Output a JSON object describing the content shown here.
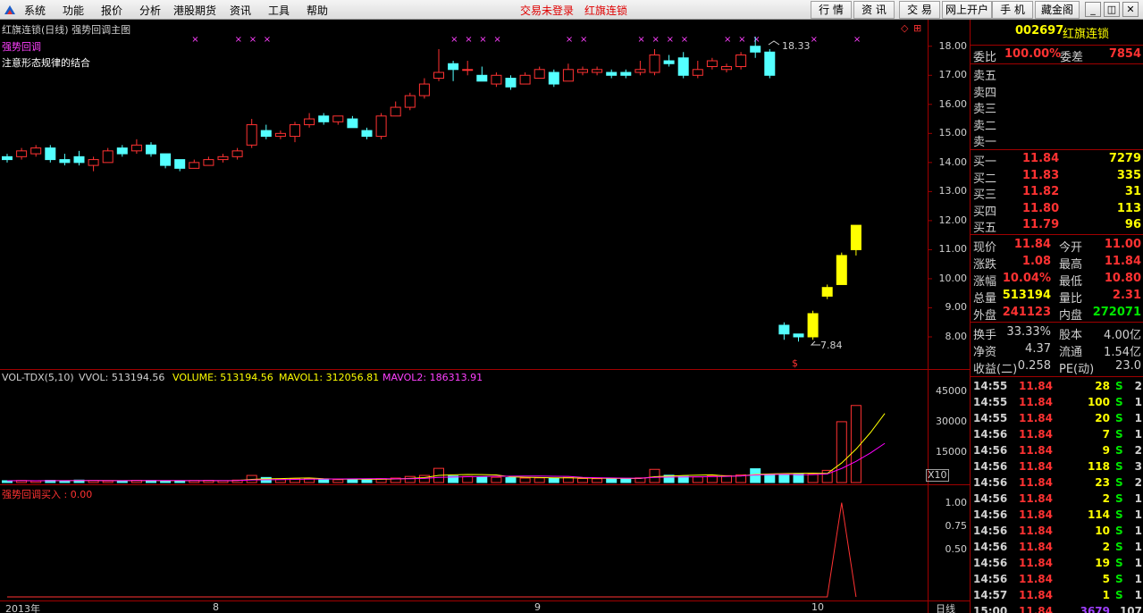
{
  "menubar": {
    "items": [
      "系统",
      "功能",
      "报价",
      "分析",
      "港股期货",
      "资讯",
      "工具",
      "帮助"
    ],
    "status": "交易未登录",
    "stock_name": "红旗连锁",
    "tabs": [
      "行 情",
      "资 讯",
      "交 易",
      "网上开户",
      "手 机",
      "藏金阁"
    ],
    "window_buttons": [
      "_",
      "◫",
      "✕"
    ]
  },
  "chart": {
    "header": "红旗连锁(日线) 强势回调主图",
    "indicator_name": "强势回调",
    "note": "注意形态规律的结合",
    "high_marker": "18.33",
    "low_marker": "7.84",
    "s_marker": "$",
    "x10_label": "X10",
    "period_label": "日线",
    "price_axis": [
      "18.00",
      "17.00",
      "16.00",
      "15.00",
      "14.00",
      "13.00",
      "12.00",
      "11.00",
      "10.00",
      "9.00",
      "8.00"
    ],
    "vol_header": {
      "name": "VOL-TDX(5,10)",
      "vvol": "VVOL: 513194.56",
      "volume": "VOLUME: 513194.56",
      "mavol1": "MAVOL1: 312056.81",
      "mavol2": "MAVOL2: 186313.91"
    },
    "vol_axis": [
      "45000",
      "30000",
      "15000"
    ],
    "sig_header": "强势回调买入 : 0.00",
    "sig_axis": [
      "1.00",
      "0.75",
      "0.50"
    ],
    "date_labels": [
      "2013年",
      "8",
      "9",
      "10"
    ],
    "colors": {
      "up": "#ff3232",
      "down": "#54ffff",
      "yellow": "#ffff00",
      "magenta": "#ff00ff",
      "frame": "#a00000"
    }
  },
  "chart_data": {
    "type": "candlestick",
    "title": "红旗连锁(日线) 强势回调主图",
    "ylim": [
      7.6,
      18.3
    ],
    "candles": [
      {
        "o": 14.2,
        "c": 14.1,
        "h": 14.3,
        "l": 14.0
      },
      {
        "o": 14.2,
        "c": 14.4,
        "h": 14.5,
        "l": 14.1
      },
      {
        "o": 14.3,
        "c": 14.5,
        "h": 14.6,
        "l": 14.2
      },
      {
        "o": 14.5,
        "c": 14.1,
        "h": 14.6,
        "l": 14.0
      },
      {
        "o": 14.1,
        "c": 14.0,
        "h": 14.3,
        "l": 13.9
      },
      {
        "o": 14.2,
        "c": 14.0,
        "h": 14.4,
        "l": 13.9
      },
      {
        "o": 13.9,
        "c": 14.1,
        "h": 14.2,
        "l": 13.7
      },
      {
        "o": 14.0,
        "c": 14.4,
        "h": 14.5,
        "l": 14.0
      },
      {
        "o": 14.5,
        "c": 14.3,
        "h": 14.6,
        "l": 14.2
      },
      {
        "o": 14.4,
        "c": 14.6,
        "h": 14.8,
        "l": 14.3
      },
      {
        "o": 14.6,
        "c": 14.3,
        "h": 14.7,
        "l": 14.2
      },
      {
        "o": 14.3,
        "c": 13.9,
        "h": 14.3,
        "l": 13.8
      },
      {
        "o": 14.1,
        "c": 13.8,
        "h": 14.1,
        "l": 13.7
      },
      {
        "o": 13.8,
        "c": 14.0,
        "h": 14.1,
        "l": 13.8
      },
      {
        "o": 13.9,
        "c": 14.1,
        "h": 14.2,
        "l": 13.9
      },
      {
        "o": 14.1,
        "c": 14.2,
        "h": 14.3,
        "l": 14.0
      },
      {
        "o": 14.2,
        "c": 14.4,
        "h": 14.5,
        "l": 14.1
      },
      {
        "o": 14.6,
        "c": 15.3,
        "h": 15.5,
        "l": 14.5
      },
      {
        "o": 15.1,
        "c": 14.9,
        "h": 15.3,
        "l": 14.8
      },
      {
        "o": 14.9,
        "c": 15.0,
        "h": 15.1,
        "l": 14.8
      },
      {
        "o": 14.9,
        "c": 15.3,
        "h": 15.4,
        "l": 14.7
      },
      {
        "o": 15.3,
        "c": 15.5,
        "h": 15.7,
        "l": 15.2
      },
      {
        "o": 15.6,
        "c": 15.4,
        "h": 15.7,
        "l": 15.3
      },
      {
        "o": 15.4,
        "c": 15.6,
        "h": 15.6,
        "l": 15.3
      },
      {
        "o": 15.5,
        "c": 15.2,
        "h": 15.6,
        "l": 15.2
      },
      {
        "o": 15.1,
        "c": 14.9,
        "h": 15.2,
        "l": 14.8
      },
      {
        "o": 14.9,
        "c": 15.6,
        "h": 15.7,
        "l": 14.8
      },
      {
        "o": 15.6,
        "c": 15.9,
        "h": 16.1,
        "l": 15.6
      },
      {
        "o": 15.9,
        "c": 16.3,
        "h": 16.4,
        "l": 15.8
      },
      {
        "o": 16.3,
        "c": 16.7,
        "h": 16.9,
        "l": 16.2
      },
      {
        "o": 16.9,
        "c": 17.1,
        "h": 17.9,
        "l": 16.8
      },
      {
        "o": 17.4,
        "c": 17.2,
        "h": 17.5,
        "l": 16.8
      },
      {
        "o": 17.2,
        "c": 17.2,
        "h": 17.5,
        "l": 17.0
      },
      {
        "o": 17.0,
        "c": 16.8,
        "h": 17.3,
        "l": 16.8
      },
      {
        "o": 16.7,
        "c": 17.0,
        "h": 17.1,
        "l": 16.6
      },
      {
        "o": 16.9,
        "c": 16.6,
        "h": 17.0,
        "l": 16.5
      },
      {
        "o": 16.7,
        "c": 17.0,
        "h": 17.1,
        "l": 16.7
      },
      {
        "o": 16.9,
        "c": 17.2,
        "h": 17.3,
        "l": 16.9
      },
      {
        "o": 17.1,
        "c": 16.7,
        "h": 17.2,
        "l": 16.6
      },
      {
        "o": 16.8,
        "c": 17.2,
        "h": 17.4,
        "l": 16.8
      },
      {
        "o": 17.1,
        "c": 17.2,
        "h": 17.3,
        "l": 17.0
      },
      {
        "o": 17.1,
        "c": 17.2,
        "h": 17.3,
        "l": 17.0
      },
      {
        "o": 17.1,
        "c": 17.0,
        "h": 17.2,
        "l": 16.9
      },
      {
        "o": 17.1,
        "c": 17.0,
        "h": 17.2,
        "l": 16.9
      },
      {
        "o": 17.1,
        "c": 17.2,
        "h": 17.5,
        "l": 17.0
      },
      {
        "o": 17.1,
        "c": 17.7,
        "h": 17.9,
        "l": 17.0
      },
      {
        "o": 17.5,
        "c": 17.4,
        "h": 17.7,
        "l": 17.3
      },
      {
        "o": 17.6,
        "c": 17.0,
        "h": 17.8,
        "l": 16.9
      },
      {
        "o": 17.0,
        "c": 17.2,
        "h": 17.5,
        "l": 16.9
      },
      {
        "o": 17.3,
        "c": 17.5,
        "h": 17.6,
        "l": 17.2
      },
      {
        "o": 17.2,
        "c": 17.3,
        "h": 17.4,
        "l": 17.1
      },
      {
        "o": 17.3,
        "c": 17.7,
        "h": 17.8,
        "l": 17.2
      },
      {
        "o": 18.0,
        "c": 17.8,
        "h": 18.33,
        "l": 17.6
      },
      {
        "o": 17.8,
        "c": 17.0,
        "h": 17.9,
        "l": 16.9
      },
      {
        "o": 8.4,
        "c": 8.1,
        "h": 8.5,
        "l": 7.9
      },
      {
        "o": 8.1,
        "c": 8.0,
        "h": 8.1,
        "l": 7.84
      },
      {
        "o": 8.0,
        "c": 8.8,
        "h": 8.9,
        "l": 7.9
      },
      {
        "o": 9.4,
        "c": 9.7,
        "h": 9.8,
        "l": 9.3
      },
      {
        "o": 9.8,
        "c": 10.8,
        "h": 10.9,
        "l": 9.8
      },
      {
        "o": 11.0,
        "c": 11.84,
        "h": 11.84,
        "l": 10.8
      }
    ],
    "volume": [
      900,
      1000,
      800,
      1100,
      900,
      1200,
      1000,
      800,
      900,
      1100,
      1000,
      900,
      800,
      1000,
      1100,
      900,
      1200,
      3500,
      2500,
      1500,
      2000,
      1800,
      1600,
      1400,
      1700,
      1500,
      1900,
      2200,
      3000,
      3500,
      7000,
      3200,
      3000,
      2800,
      2600,
      2400,
      2200,
      2300,
      2100,
      2500,
      2000,
      1900,
      1800,
      1900,
      2300,
      6500,
      3600,
      3000,
      2800,
      3200,
      3400,
      3800,
      6800,
      3900,
      4000,
      4200,
      4100,
      6000,
      30000,
      38000,
      45000,
      51319
    ],
    "volume_ylim": [
      0,
      52000
    ],
    "signal": [
      {
        "x": 58,
        "y": 1.0
      }
    ],
    "signal_ylim": [
      0,
      1.1
    ],
    "x_labels": [
      "2013年",
      "8",
      "9",
      "10"
    ]
  },
  "quote": {
    "code": "002697",
    "name": "红旗连锁",
    "weibi_label": "委比",
    "weibi_value": "100.00%",
    "weicha_label": "委差",
    "weicha_value": "7854",
    "sell": [
      {
        "label": "卖五",
        "price": "",
        "vol": ""
      },
      {
        "label": "卖四",
        "price": "",
        "vol": ""
      },
      {
        "label": "卖三",
        "price": "",
        "vol": ""
      },
      {
        "label": "卖二",
        "price": "",
        "vol": ""
      },
      {
        "label": "卖一",
        "price": "",
        "vol": ""
      }
    ],
    "buy": [
      {
        "label": "买一",
        "price": "11.84",
        "vol": "7279"
      },
      {
        "label": "买二",
        "price": "11.83",
        "vol": "335"
      },
      {
        "label": "买三",
        "price": "11.82",
        "vol": "31"
      },
      {
        "label": "买四",
        "price": "11.80",
        "vol": "113"
      },
      {
        "label": "买五",
        "price": "11.79",
        "vol": "96"
      }
    ],
    "stats": [
      {
        "l1": "现价",
        "v1": "11.84",
        "c1": "#ff3232",
        "l2": "今开",
        "v2": "11.00",
        "c2": "#ff3232"
      },
      {
        "l1": "涨跌",
        "v1": "1.08",
        "c1": "#ff3232",
        "l2": "最高",
        "v2": "11.84",
        "c2": "#ff3232"
      },
      {
        "l1": "涨幅",
        "v1": "10.04%",
        "c1": "#ff3232",
        "l2": "最低",
        "v2": "10.80",
        "c2": "#ff3232"
      },
      {
        "l1": "总量",
        "v1": "513194",
        "c1": "#ffff00",
        "l2": "量比",
        "v2": "2.31",
        "c2": "#ff3232"
      },
      {
        "l1": "外盘",
        "v1": "241123",
        "c1": "#ff3232",
        "l2": "内盘",
        "v2": "272071",
        "c2": "#00e600"
      }
    ],
    "stats2": [
      {
        "l1": "换手",
        "v1": "33.33%",
        "l2": "股本",
        "v2": "4.00亿"
      },
      {
        "l1": "净资",
        "v1": "4.37",
        "l2": "流通",
        "v2": "1.54亿"
      },
      {
        "l1": "收益(二)",
        "v1": "0.258",
        "l2": "PE(动)",
        "v2": "23.0"
      }
    ]
  },
  "ticks": [
    {
      "time": "14:55",
      "price": "11.84",
      "vol": "28",
      "bs": "S",
      "n": "2"
    },
    {
      "time": "14:55",
      "price": "11.84",
      "vol": "100",
      "bs": "S",
      "n": "1"
    },
    {
      "time": "14:55",
      "price": "11.84",
      "vol": "20",
      "bs": "S",
      "n": "1"
    },
    {
      "time": "14:56",
      "price": "11.84",
      "vol": "7",
      "bs": "S",
      "n": "1"
    },
    {
      "time": "14:56",
      "price": "11.84",
      "vol": "9",
      "bs": "S",
      "n": "2"
    },
    {
      "time": "14:56",
      "price": "11.84",
      "vol": "118",
      "bs": "S",
      "n": "3"
    },
    {
      "time": "14:56",
      "price": "11.84",
      "vol": "23",
      "bs": "S",
      "n": "2"
    },
    {
      "time": "14:56",
      "price": "11.84",
      "vol": "2",
      "bs": "S",
      "n": "1"
    },
    {
      "time": "14:56",
      "price": "11.84",
      "vol": "114",
      "bs": "S",
      "n": "1"
    },
    {
      "time": "14:56",
      "price": "11.84",
      "vol": "10",
      "bs": "S",
      "n": "1"
    },
    {
      "time": "14:56",
      "price": "11.84",
      "vol": "2",
      "bs": "S",
      "n": "1"
    },
    {
      "time": "14:56",
      "price": "11.84",
      "vol": "19",
      "bs": "S",
      "n": "1"
    },
    {
      "time": "14:56",
      "price": "11.84",
      "vol": "5",
      "bs": "S",
      "n": "1"
    },
    {
      "time": "14:57",
      "price": "11.84",
      "vol": "1",
      "bs": "S",
      "n": "1"
    },
    {
      "time": "15:00",
      "price": "11.84",
      "vol": "3679",
      "bs": "",
      "n": "107"
    }
  ]
}
